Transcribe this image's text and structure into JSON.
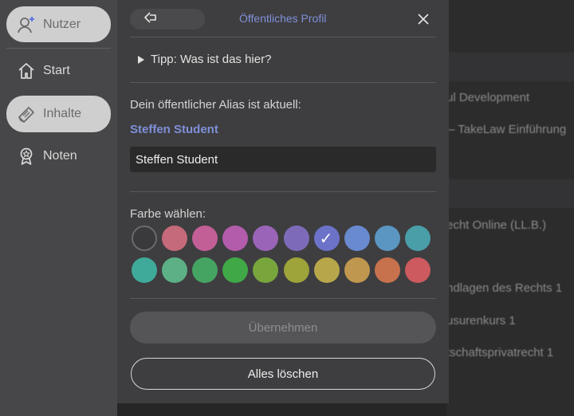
{
  "sidebar": {
    "items": [
      {
        "label": "Nutzer",
        "icon": "user-plus-icon"
      },
      {
        "label": "Start",
        "icon": "home-icon"
      },
      {
        "label": "Inhalte",
        "icon": "book-icon"
      },
      {
        "label": "Noten",
        "icon": "award-icon"
      }
    ]
  },
  "header": {
    "title": "Öffentliches Profil"
  },
  "tip": {
    "label": "Tipp: Was ist das hier?"
  },
  "alias": {
    "label": "Dein öffentlicher Alias ist aktuell:",
    "current": "Steffen Student",
    "input_value": "Steffen Student"
  },
  "colors": {
    "label": "Farbe wählen:",
    "selected_index": 6,
    "swatches": [
      "none",
      "#c56a7a",
      "#c25f97",
      "#b25cab",
      "#9a64b8",
      "#7d6bb9",
      "#6c72c8",
      "#6a8ad0",
      "#5b95c2",
      "#4a9ea8",
      "#3faa9a",
      "#5daf85",
      "#46a463",
      "#40a847",
      "#78a63d",
      "#9ea33a",
      "#b8a74a",
      "#c0974f",
      "#c7724d",
      "#cc5a5e"
    ]
  },
  "buttons": {
    "apply": "Übernehmen",
    "clear": "Alles löschen"
  },
  "background_list": [
    "ul Development",
    "– TakeLaw Einführung",
    "echt Online (LL.B.)",
    "ndlagen des Rechts 1",
    "usurenkurs 1",
    "tschaftsprivatrecht 1"
  ]
}
